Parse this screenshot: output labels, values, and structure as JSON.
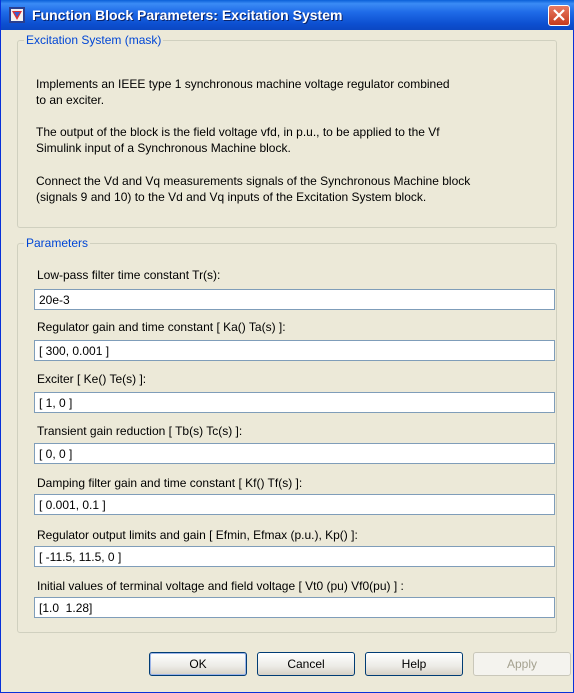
{
  "window": {
    "title": "Function Block Parameters: Excitation System"
  },
  "mask_group": {
    "legend": "Excitation System (mask)",
    "description": [
      "Implements an IEEE type 1 synchronous machine voltage regulator combined",
      "to an exciter.",
      "The output of the block is the field voltage vfd, in p.u.,  to be applied to the Vf",
      "Simulink input of a Synchronous Machine block.",
      "Connect the Vd and Vq measurements signals of the Synchronous Machine block",
      "(signals 9 and 10)  to  the Vd and Vq inputs of the Excitation System block."
    ]
  },
  "params_group": {
    "legend": "Parameters",
    "params": [
      {
        "label": "Low-pass filter time constant Tr(s):",
        "value": "20e-3"
      },
      {
        "label": "Regulator gain and time constant [ Ka()  Ta(s) ]:",
        "value": "[ 300, 0.001 ]"
      },
      {
        "label": "Exciter  [ Ke()  Te(s) ]:",
        "value": "[ 1, 0 ]"
      },
      {
        "label": "Transient gain reduction [ Tb(s)  Tc(s) ]:",
        "value": "[ 0, 0 ]"
      },
      {
        "label": "Damping filter gain and time constant  [ Kf()  Tf(s)  ]:",
        "value": "[ 0.001, 0.1 ]"
      },
      {
        "label": "Regulator output limits and gain [ Efmin, Efmax (p.u.), Kp() ]:",
        "value": "[ -11.5, 11.5, 0 ]"
      },
      {
        "label": "Initial values of terminal voltage  and field voltage [ Vt0 (pu) Vf0(pu) ] :",
        "value": "[1.0  1.28]"
      }
    ]
  },
  "buttons": {
    "ok": "OK",
    "cancel": "Cancel",
    "help": "Help",
    "apply": "Apply"
  },
  "icons": {
    "window_icon": "simulink-block-icon",
    "close": "close-icon"
  },
  "colors": {
    "titlebar": "#0b52d6",
    "legend_text": "#0046d5",
    "dialog_bg": "#ece9d8"
  }
}
